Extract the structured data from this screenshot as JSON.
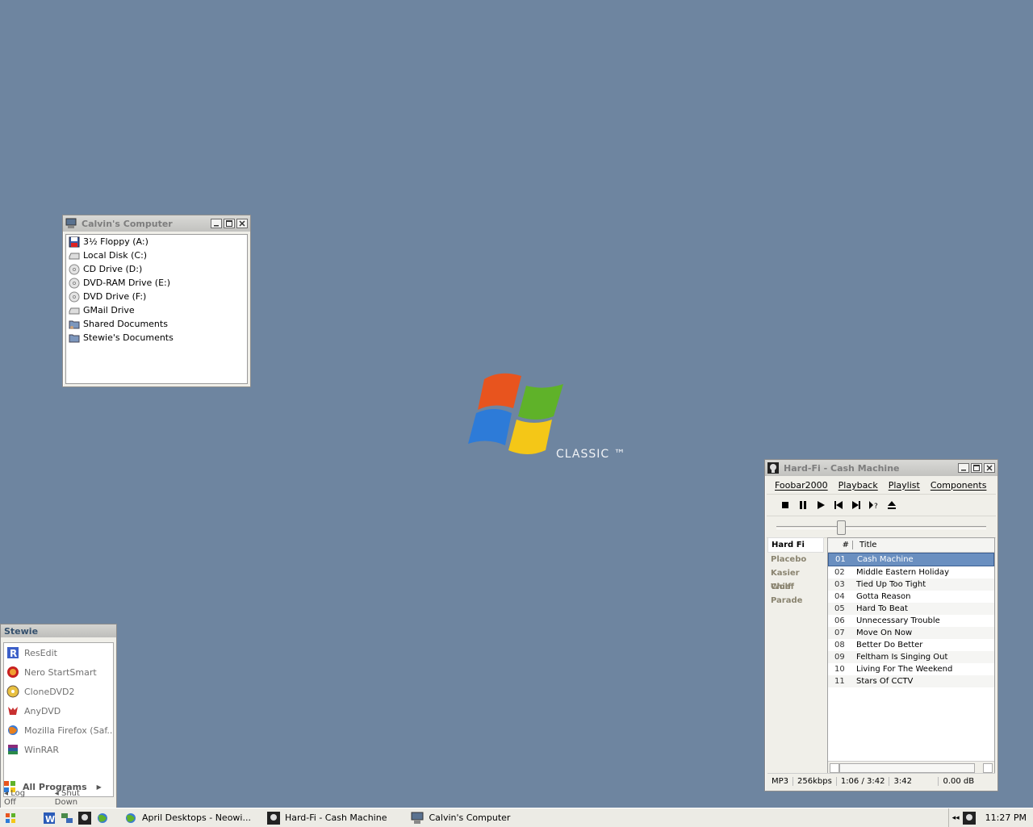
{
  "desktop": {
    "logo_text": "CLASSIC ™"
  },
  "computer_window": {
    "title": "Calvin's Computer",
    "items": [
      {
        "label": "3½ Floppy (A:)",
        "icon": "floppy-icon"
      },
      {
        "label": "Local Disk (C:)",
        "icon": "hard-disk-icon"
      },
      {
        "label": "CD Drive (D:)",
        "icon": "cd-drive-icon"
      },
      {
        "label": "DVD-RAM Drive (E:)",
        "icon": "cd-drive-icon"
      },
      {
        "label": "DVD Drive (F:)",
        "icon": "cd-drive-icon"
      },
      {
        "label": "GMail Drive",
        "icon": "hard-disk-icon"
      },
      {
        "label": "Shared Documents",
        "icon": "shared-folder-icon"
      },
      {
        "label": "Stewie's Documents",
        "icon": "folder-icon"
      }
    ]
  },
  "foobar": {
    "title": "Hard-Fi - Cash Machine",
    "menu": [
      "Foobar2000",
      "Playback",
      "Playlist",
      "Components"
    ],
    "artists": [
      {
        "name": "Hard Fi",
        "selected": true
      },
      {
        "name": "Placebo"
      },
      {
        "name": "Kasier Chief"
      },
      {
        "name": "Wolf Parade"
      }
    ],
    "playlist_header": {
      "num": "#",
      "title": "Title"
    },
    "tracks": [
      {
        "num": "01",
        "title": "Cash Machine",
        "selected": true
      },
      {
        "num": "02",
        "title": "Middle Eastern Holiday"
      },
      {
        "num": "03",
        "title": "Tied Up Too Tight"
      },
      {
        "num": "04",
        "title": "Gotta Reason"
      },
      {
        "num": "05",
        "title": "Hard To Beat"
      },
      {
        "num": "06",
        "title": "Unnecessary Trouble"
      },
      {
        "num": "07",
        "title": "Move On Now"
      },
      {
        "num": "08",
        "title": "Better Do Better"
      },
      {
        "num": "09",
        "title": "Feltham Is Singing Out"
      },
      {
        "num": "10",
        "title": "Living For The Weekend"
      },
      {
        "num": "11",
        "title": "Stars Of CCTV"
      }
    ],
    "seek_position": 0.3,
    "status": {
      "codec": "MP3",
      "bitrate": "256kbps",
      "time": "1:06 / 3:42",
      "length": "3:42",
      "volume": "0.00 dB"
    }
  },
  "start_menu": {
    "user": "Stewie",
    "items": [
      {
        "label": "ResEdit",
        "icon": "resedit-icon"
      },
      {
        "label": "Nero StartSmart",
        "icon": "nero-icon"
      },
      {
        "label": "CloneDVD2",
        "icon": "clonedvd-icon"
      },
      {
        "label": "AnyDVD",
        "icon": "anydvd-icon"
      },
      {
        "label": "Mozilla Firefox (Saf...",
        "icon": "firefox-icon"
      },
      {
        "label": "WinRAR",
        "icon": "winrar-icon"
      }
    ],
    "all_programs": "All Programs",
    "log_off": "Log Off",
    "shut_down": "Shut Down"
  },
  "taskbar": {
    "tasks": [
      {
        "label": "April Desktops - Neowi...",
        "icon": "browser-icon"
      },
      {
        "label": "Hard-Fi - Cash Machine",
        "icon": "foobar-icon"
      },
      {
        "label": "Calvin's Computer",
        "icon": "computer-icon"
      }
    ],
    "clock": "11:27 PM"
  }
}
